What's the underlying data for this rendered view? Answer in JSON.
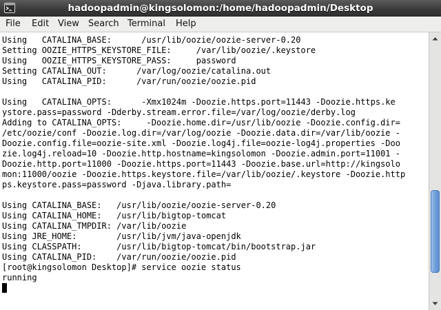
{
  "window": {
    "title": "hadoopadmin@kingsolomon:/home/hadoopadmin/Desktop",
    "icon": "terminal-icon"
  },
  "menu": {
    "items": [
      "File",
      "Edit",
      "View",
      "Search",
      "Terminal",
      "Help"
    ]
  },
  "terminal": {
    "lines": [
      "Using   CATALINA_BASE:      /usr/lib/oozie/oozie-server-0.20",
      "Setting OOZIE_HTTPS_KEYSTORE_FILE:     /var/lib/oozie/.keystore",
      "Using   OOZIE_HTTPS_KEYSTORE_PASS:     password",
      "Setting CATALINA_OUT:      /var/log/oozie/catalina.out",
      "Using   CATALINA_PID:      /var/run/oozie/oozie.pid",
      "",
      "Using   CATALINA_OPTS:      -Xmx1024m -Doozie.https.port=11443 -Doozie.https.ke",
      "ystore.pass=password -Dderby.stream.error.file=/var/log/oozie/derby.log",
      "Adding to CATALINA_OPTS:     -Doozie.home.dir=/usr/lib/oozie -Doozie.config.dir=",
      "/etc/oozie/conf -Doozie.log.dir=/var/log/oozie -Doozie.data.dir=/var/lib/oozie -",
      "Doozie.config.file=oozie-site.xml -Doozie.log4j.file=oozie-log4j.properties -Doo",
      "zie.log4j.reload=10 -Doozie.http.hostname=kingsolomon -Doozie.admin.port=11001 -",
      "Doozie.http.port=11000 -Doozie.https.port=11443 -Doozie.base.url=http://kingsolo",
      "mon:11000/oozie -Doozie.https.keystore.file=/var/lib/oozie/.keystore -Doozie.http",
      "ps.keystore.pass=password -Djava.library.path=",
      "",
      "Using CATALINA_BASE:   /usr/lib/oozie/oozie-server-0.20",
      "Using CATALINA_HOME:   /usr/lib/bigtop-tomcat",
      "Using CATALINA_TMPDIR: /var/lib/oozie",
      "Using JRE_HOME:        /usr/lib/jvm/java-openjdk",
      "Using CLASSPATH:       /usr/lib/bigtop-tomcat/bin/bootstrap.jar",
      "Using CATALINA_PID:    /var/run/oozie/oozie.pid",
      "[root@kingsolomon Desktop]# service oozie status",
      "running"
    ],
    "prompt": "[root@kingsolomon Desktop]# "
  },
  "scrollbar": {
    "position": 0.86
  },
  "colors": {
    "titlebar": "#3b3b3b",
    "menubar": "#eeeeec",
    "terminal_bg": "#ffffff",
    "terminal_fg": "#000000",
    "scroll_thumb": "#6f9fd9"
  }
}
